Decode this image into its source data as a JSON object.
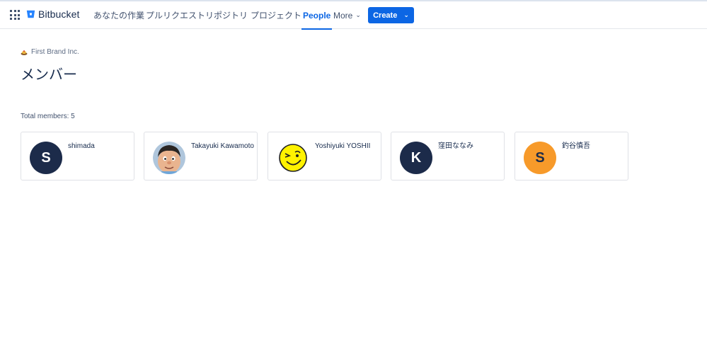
{
  "nav": {
    "product_name": "Bitbucket",
    "items": [
      {
        "label": "あなたの作業"
      },
      {
        "label": "プルリクエスト"
      },
      {
        "label": "リポジトリ"
      },
      {
        "label": "プロジェクト"
      },
      {
        "label": "People",
        "active": true
      },
      {
        "label": "More"
      }
    ],
    "create_label": "Create",
    "icons": {
      "apps": "app-switcher-icon",
      "logo": "bitbucket-logo",
      "more": "chevron-down-icon",
      "create": "chevron-down-icon"
    },
    "accent_color": "#0C66E4"
  },
  "breadcrumb": {
    "workspace": "First Brand Inc."
  },
  "page": {
    "title": "メンバー",
    "total_members": "Total members: 5"
  },
  "members": [
    {
      "initial": "S",
      "name": "shimada",
      "avatar": "initial",
      "color": "#1C2B4A"
    },
    {
      "name": "Takayuki Kawamoto",
      "avatar": "cartoon-boy-icon"
    },
    {
      "name": "Yoshiyuki YOSHII",
      "avatar": "winking-smiley-icon"
    },
    {
      "initial": "K",
      "name": "窪田ななみ",
      "avatar": "initial",
      "color": "#1C2B4A"
    },
    {
      "initial": "S",
      "name": "釣谷慎吾",
      "avatar": "initial",
      "color": "#F79A2A"
    }
  ]
}
